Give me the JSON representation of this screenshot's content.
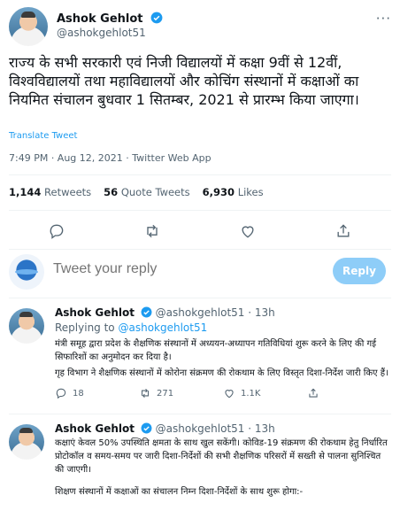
{
  "tweet": {
    "author_name": "Ashok Gehlot",
    "author_handle": "@ashokgehlot51",
    "text": "राज्य के सभी सरकारी एवं निजी विद्यालयों में कक्षा 9वीं से 12वीं, विश्वविद्यालयों तथा महाविद्यालयों और कोचिंग संस्थानों में कक्षाओं का नियमित संचालन बुधवार 1 सितम्बर, 2021 से प्रारम्भ किया जाएगा।",
    "translate_label": "Translate Tweet",
    "meta": "7:49 PM · Aug 12, 2021 · Twitter Web App",
    "stats": {
      "retweets_count": "1,144",
      "retweets_label": "Retweets",
      "quotes_count": "56",
      "quotes_label": "Quote Tweets",
      "likes_count": "6,930",
      "likes_label": "Likes"
    }
  },
  "compose": {
    "placeholder": "Tweet your reply",
    "reply_label": "Reply"
  },
  "replies": [
    {
      "author_name": "Ashok Gehlot",
      "author_handle": "@ashokgehlot51",
      "time": "· 13h",
      "replying_prefix": "Replying to",
      "replying_to": "@ashokgehlot51",
      "paragraphs": [
        "मंत्री समूह द्वारा प्रदेश के शैक्षणिक संस्थानों में अध्ययन-अध्यापन गतिविधियां शुरू करने के लिए की गई सिफारिशों का अनुमोदन कर दिया है।",
        "गृह विभाग ने शैक्षणिक संस्थानों में कोरोना संक्रमण की रोकथाम के लिए विस्तृत दिशा-निर्देश जारी किए हैं।"
      ],
      "replies_count": "18",
      "retweets_count": "271",
      "likes_count": "1.1K"
    },
    {
      "author_name": "Ashok Gehlot",
      "author_handle": "@ashokgehlot51",
      "time": "· 13h",
      "paragraphs": [
        "कक्षाएं केवल 50% उपस्थिति क्षमता के साथ खुल सकेंगी। कोविड-19 संक्रमण की रोकथाम हेतु निर्धारित प्रोटोकॉल व समय-समय पर जारी दिशा-निर्देशों की सभी शैक्षणिक परिसरों में सख्ती से पालना सुनिश्चित की जाएगी।",
        "शिक्षण संस्थानों में कक्षाओं का संचालन निम्न दिशा-निर्देशों के साथ शुरू होगा:-"
      ]
    }
  ],
  "colors": {
    "accent": "#1d9bf0",
    "muted": "#536471",
    "reply_button": "#8ecdf8"
  },
  "icons": [
    "verified-badge-icon",
    "more-icon",
    "reply-icon",
    "retweet-icon",
    "like-icon",
    "share-icon"
  ]
}
